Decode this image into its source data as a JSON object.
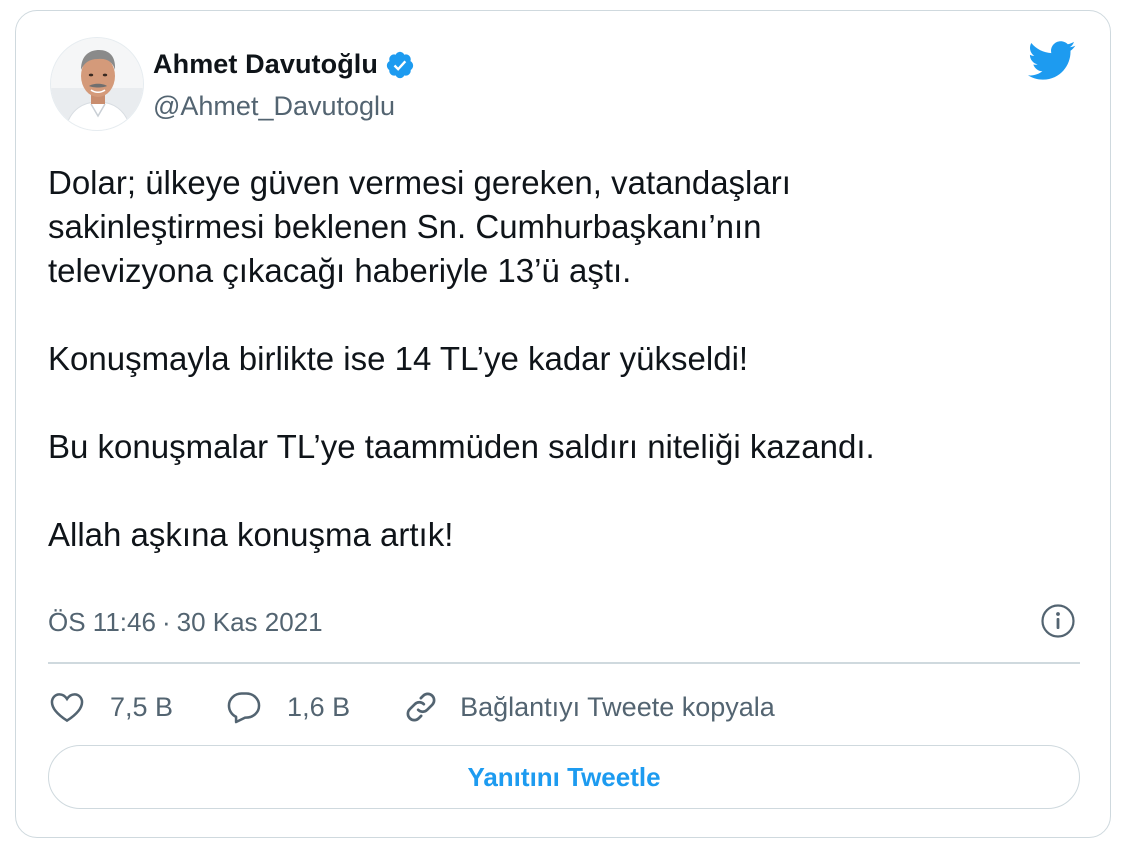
{
  "author": {
    "display_name": "Ahmet Davutoğlu",
    "handle": "@Ahmet_Davutoglu",
    "verified": true,
    "avatar_icon": "profile-photo"
  },
  "tweet": {
    "paragraphs": [
      "Dolar; ülkeye güven vermesi gereken, vatandaşları\nsakinleştirmesi beklenen Sn. Cumhurbaşkanı’nın\ntelevizyona çıkacağı haberiyle 13’ü aştı.",
      "Konuşmayla birlikte ise 14 TL’ye kadar yükseldi!",
      "Bu konuşmalar TL’ye taammüden saldırı niteliği kazandı.",
      "Allah aşkına konuşma artık!"
    ],
    "time": "ÖS 11:46",
    "separator": "·",
    "date": "30 Kas 2021"
  },
  "actions": {
    "likes": "7,5 B",
    "replies": "1,6 B",
    "copy_link_label": "Bağlantıyı Tweete kopyala"
  },
  "reply_button_label": "Yanıtını Tweetle",
  "colors": {
    "accent": "#1d9bf0",
    "secondary_text": "#536471",
    "border": "#cfd9de"
  },
  "icons": [
    "twitter-bird-icon",
    "verified-badge-icon",
    "info-icon",
    "heart-icon",
    "comment-icon",
    "link-icon"
  ]
}
